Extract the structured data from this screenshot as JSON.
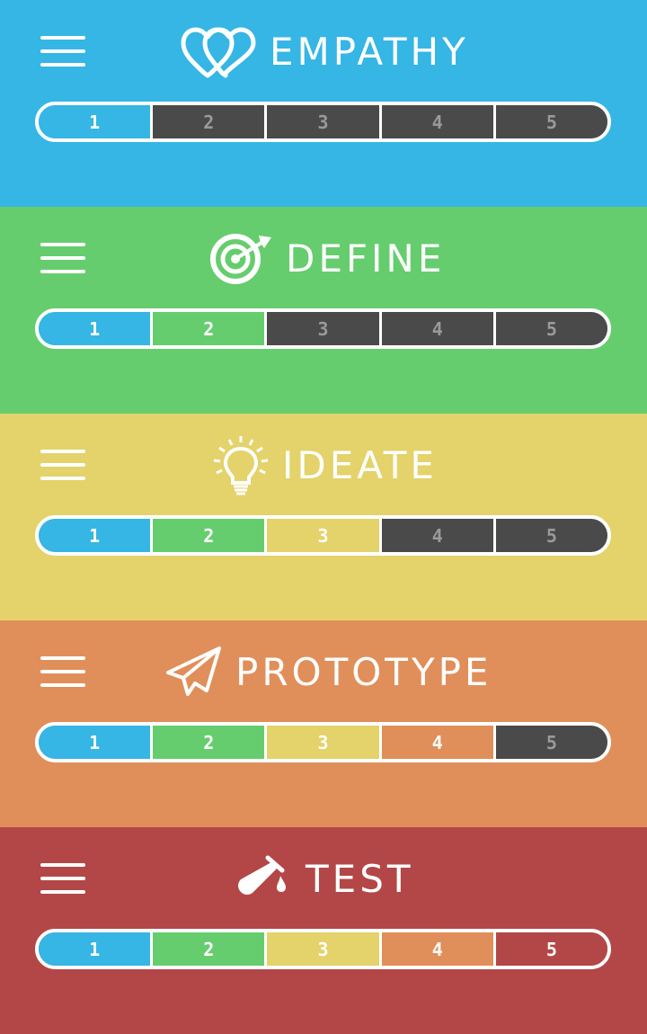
{
  "steps": [
    "1",
    "2",
    "3",
    "4",
    "5"
  ],
  "colors": {
    "empathy": "#35b6e4",
    "define": "#66cd6e",
    "ideate": "#e4d26a",
    "prototype": "#e08f5a",
    "test": "#b34747",
    "inactive": "#4a4a4a"
  },
  "panels": [
    {
      "title": "EMPATHY",
      "icon": "hearts-icon",
      "active_steps": 1
    },
    {
      "title": "DEFINE",
      "icon": "target-icon",
      "active_steps": 2
    },
    {
      "title": "IDEATE",
      "icon": "lightbulb-icon",
      "active_steps": 3
    },
    {
      "title": "PROTOTYPE",
      "icon": "paper-plane-icon",
      "active_steps": 4
    },
    {
      "title": "TEST",
      "icon": "test-tube-icon",
      "active_steps": 5
    }
  ]
}
